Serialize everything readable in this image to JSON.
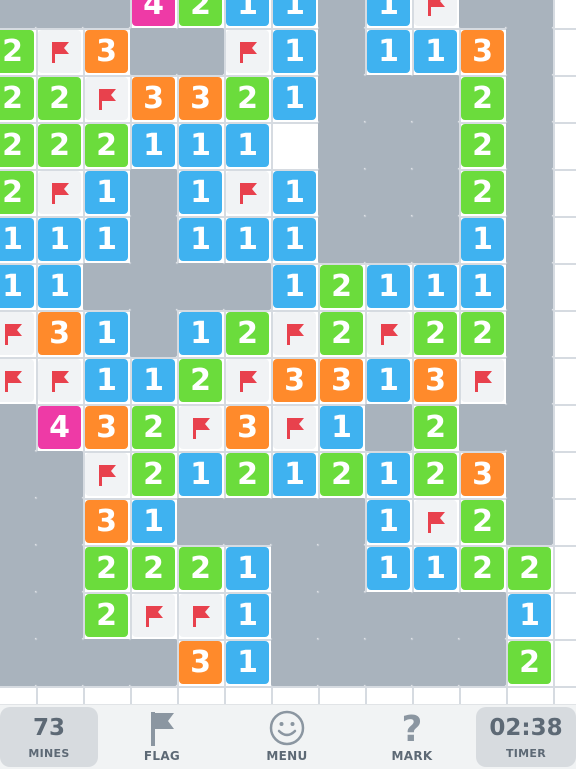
{
  "board": {
    "rows": [
      "...4211.1F..",
      "2F3..F1.113.",
      "22F3321...2.",
      "222111 ...2.",
      "2F1.1F1...2.",
      "111.111...1.",
      "11....12111.",
      "F31.12F2F22.",
      "FF112F3313F.",
      ".432F3F1.2..",
      "..F21212123.",
      "..31....1F2.",
      "..2221..1122",
      "..2FF1.....1",
      "....31.....2"
    ],
    "legend": {
      "1": "number-1",
      "2": "number-2",
      "3": "number-3",
      "4": "number-4",
      "F": "flag",
      ".": "revealed-empty",
      " ": "unrevealed"
    }
  },
  "colors": {
    "number_1": "#3fb2f0",
    "number_2": "#6bdc3c",
    "number_3": "#ff8a2b",
    "number_4": "#ee3aa6",
    "revealed": "#a9b3bd",
    "flag": "#e8414d"
  },
  "toolbar": {
    "mines_count": "73",
    "mines_label": "MINES",
    "flag_label": "FLAG",
    "menu_label": "MENU",
    "mark_label": "MARK",
    "timer_value": "02:38",
    "timer_label": "TIMER"
  },
  "icons": {
    "flag": "flag-icon",
    "menu": "smiley-icon",
    "mark": "question-mark-icon"
  }
}
